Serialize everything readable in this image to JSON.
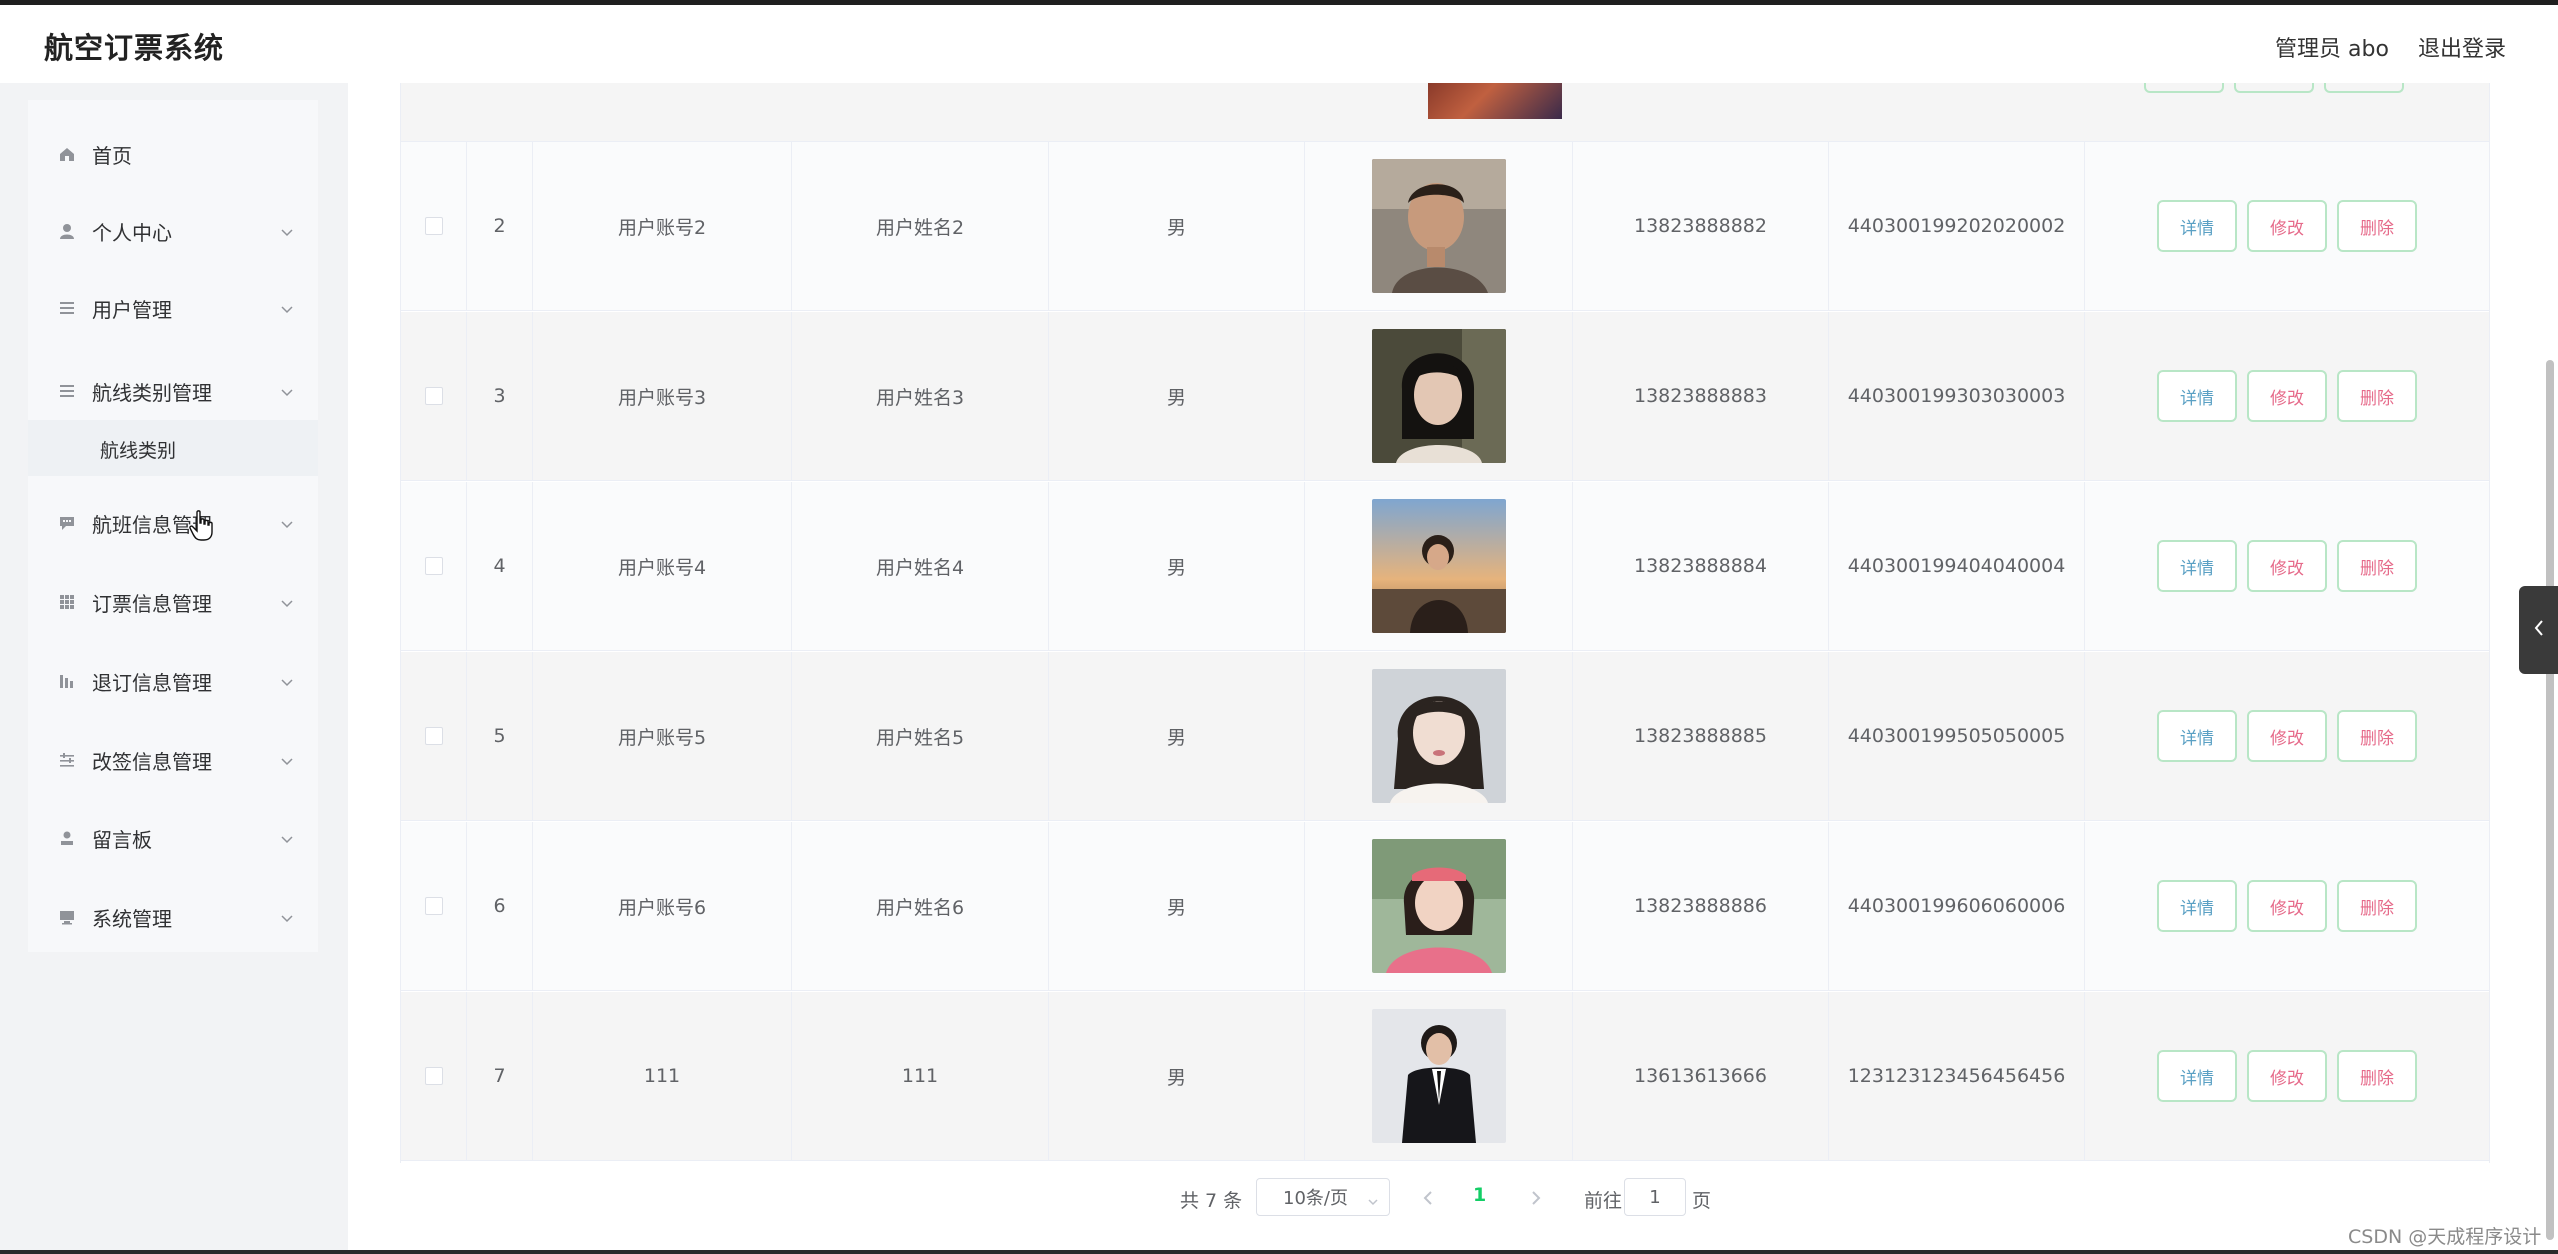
{
  "header": {
    "title": "航空订票系统",
    "user": "管理员 abo",
    "logout": "退出登录"
  },
  "menu": [
    {
      "label": "首页",
      "icon": "home-icon"
    },
    {
      "label": "个人中心",
      "icon": "user-icon"
    },
    {
      "label": "用户管理",
      "icon": "list-icon"
    },
    {
      "label": "航线类别管理",
      "icon": "list-icon"
    },
    {
      "label": "航班信息管理",
      "icon": "chat-icon"
    },
    {
      "label": "订票信息管理",
      "icon": "grid-icon"
    },
    {
      "label": "退订信息管理",
      "icon": "bar-icon"
    },
    {
      "label": "改签信息管理",
      "icon": "sliders-icon"
    },
    {
      "label": "留言板",
      "icon": "person-icon"
    },
    {
      "label": "系统管理",
      "icon": "monitor-icon"
    }
  ],
  "submenu": {
    "label": "航线类别"
  },
  "table": {
    "rows": [
      {
        "index": "2",
        "account": "用户账号2",
        "name": "用户姓名2",
        "sex": "男",
        "phone": "13823888882",
        "id_card": "440300199202020002"
      },
      {
        "index": "3",
        "account": "用户账号3",
        "name": "用户姓名3",
        "sex": "男",
        "phone": "13823888883",
        "id_card": "440300199303030003"
      },
      {
        "index": "4",
        "account": "用户账号4",
        "name": "用户姓名4",
        "sex": "男",
        "phone": "13823888884",
        "id_card": "440300199404040004"
      },
      {
        "index": "5",
        "account": "用户账号5",
        "name": "用户姓名5",
        "sex": "男",
        "phone": "13823888885",
        "id_card": "440300199505050005"
      },
      {
        "index": "6",
        "account": "用户账号6",
        "name": "用户姓名6",
        "sex": "男",
        "phone": "13823888886",
        "id_card": "440300199606060006"
      },
      {
        "index": "7",
        "account": "111",
        "name": "111",
        "sex": "男",
        "phone": "13613613666",
        "id_card": "123123123456456456"
      }
    ],
    "actions": {
      "detail": "详情",
      "edit": "修改",
      "delete": "删除"
    }
  },
  "pagination": {
    "total": "共 7 条",
    "page_size": "10条/页",
    "current": "1",
    "goto_label": "前往",
    "goto_value": "1",
    "page_unit": "页"
  },
  "watermark": "CSDN @天成程序设计",
  "colors": {
    "accent_green": "#13ce66",
    "button_border": "#b8e6c6",
    "detail_text": "#5aa0c4",
    "edit_delete_text": "#e66a8a"
  }
}
